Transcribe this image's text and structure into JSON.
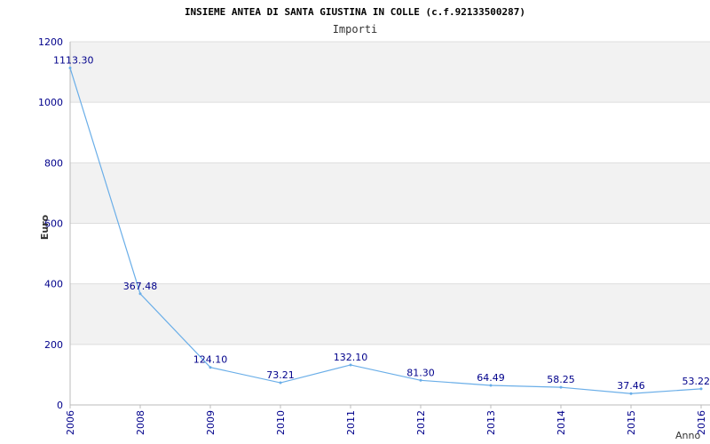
{
  "chart_data": {
    "type": "line",
    "title": "INSIEME ANTEA DI SANTA GIUSTINA IN COLLE (c.f.92133500287)",
    "subtitle": "Importi",
    "ylabel": "Euro",
    "xlabel": "Anno",
    "ylim": [
      0,
      1200
    ],
    "yticks": [
      0,
      200,
      400,
      600,
      800,
      1000,
      1200
    ],
    "categories": [
      "2006",
      "2008",
      "2009",
      "2010",
      "2011",
      "2012",
      "2013",
      "2014",
      "2015",
      "2016"
    ],
    "values": [
      1113.3,
      367.48,
      124.1,
      73.21,
      132.1,
      81.3,
      64.49,
      58.25,
      37.46,
      53.22
    ],
    "value_labels": [
      "1113.30",
      "367.48",
      "124.10",
      "73.21",
      "132.10",
      "81.30",
      "64.49",
      "58.25",
      "37.46",
      "53.22"
    ],
    "grid": true,
    "colors": {
      "line": "#6aaee8",
      "band": "#f2f2f2",
      "grid": "#dddddd",
      "labels": "#00008b"
    }
  }
}
